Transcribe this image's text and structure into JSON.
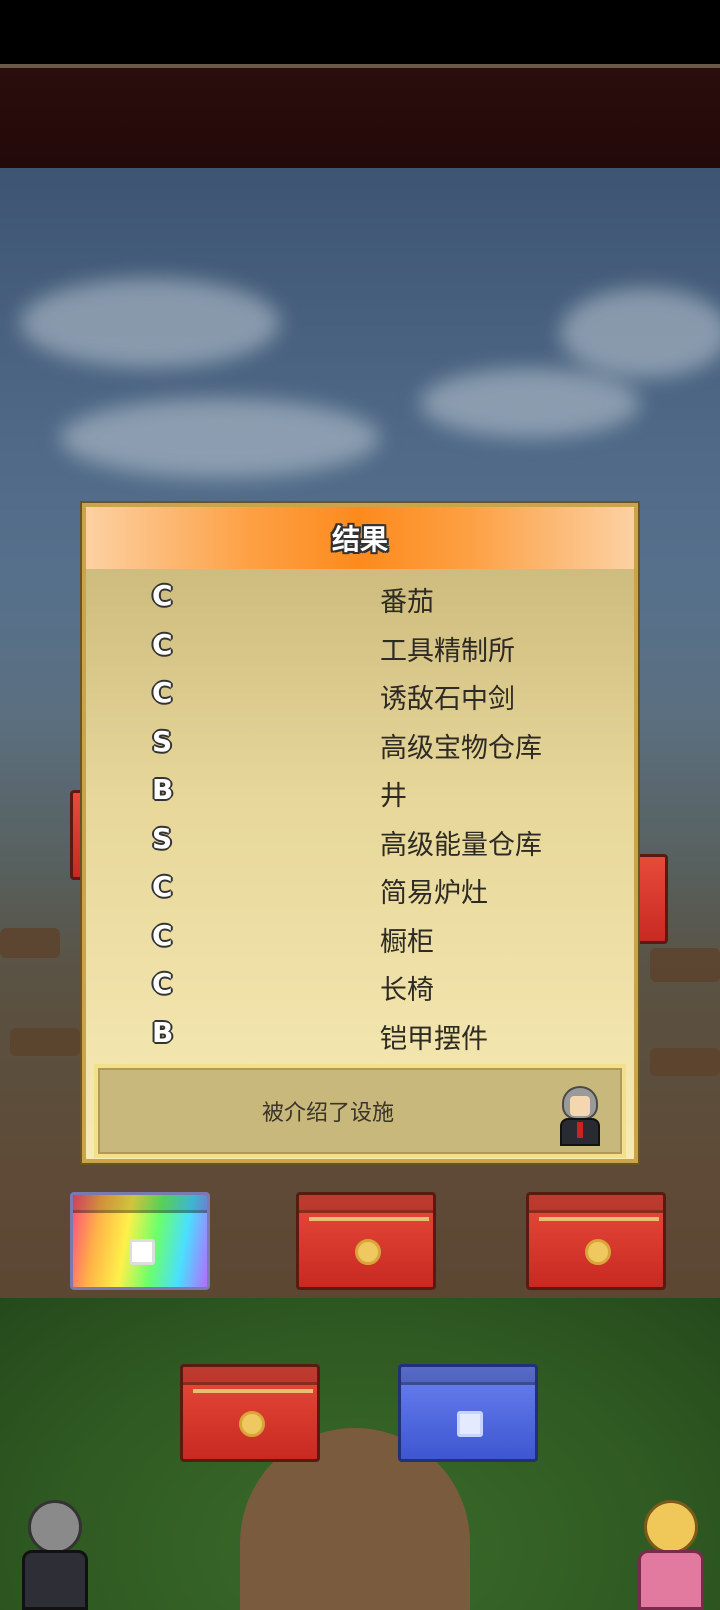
{
  "dialog": {
    "title": "结果",
    "results": [
      {
        "rank": "C",
        "name": "番茄"
      },
      {
        "rank": "C",
        "name": "工具精制所"
      },
      {
        "rank": "C",
        "name": "诱敌石中剑"
      },
      {
        "rank": "S",
        "name": "高级宝物仓库"
      },
      {
        "rank": "B",
        "name": "井"
      },
      {
        "rank": "S",
        "name": "高级能量仓库"
      },
      {
        "rank": "C",
        "name": "简易炉灶"
      },
      {
        "rank": "C",
        "name": "橱柜"
      },
      {
        "rank": "C",
        "name": "长椅"
      },
      {
        "rank": "B",
        "name": "铠甲摆件"
      }
    ],
    "message": "被介绍了设施"
  },
  "colors": {
    "header_orange": "#fd8a1c",
    "panel_frame": "#c9a44a",
    "chest_red": "#c82a22",
    "chest_blue": "#3e56d0"
  },
  "icons": {
    "advisor": "advisor-portrait-icon",
    "chests": [
      "rainbow-chest-icon",
      "red-chest-icon",
      "red-chest-icon",
      "red-chest-icon",
      "blue-chest-icon"
    ]
  }
}
